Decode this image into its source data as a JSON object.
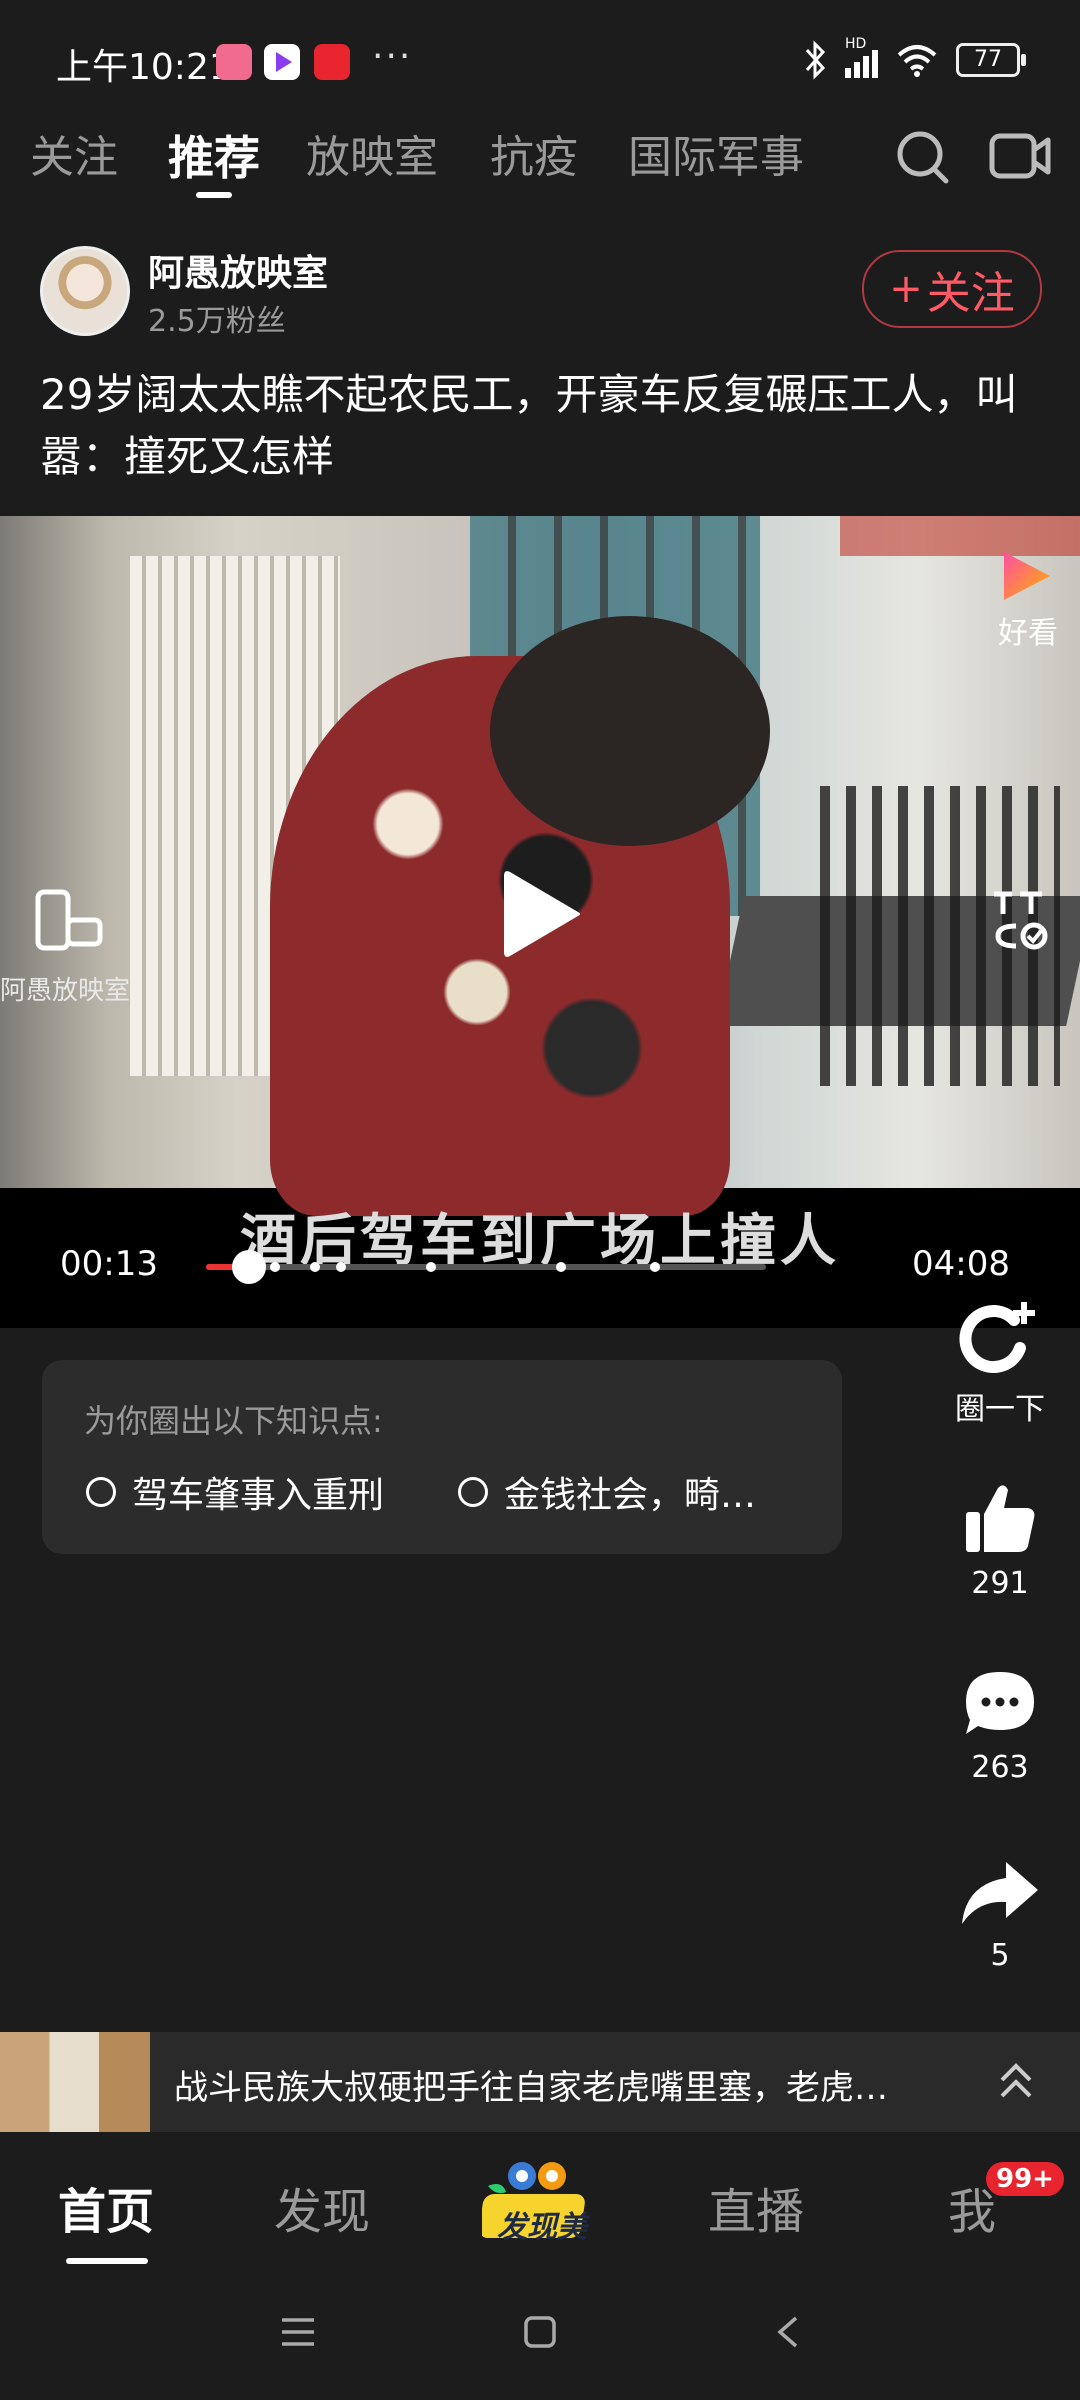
{
  "status_bar": {
    "time": "上午10:21",
    "more": "···",
    "battery": "77",
    "network_label": "HD"
  },
  "tabs": [
    {
      "label": "关注",
      "active": false
    },
    {
      "label": "推荐",
      "active": true
    },
    {
      "label": "放映室",
      "active": false
    },
    {
      "label": "抗疫",
      "active": false
    },
    {
      "label": "国际军事",
      "active": false
    }
  ],
  "author": {
    "name": "阿愚放映室",
    "fans": "2.5万粉丝",
    "follow_label": "关注"
  },
  "video": {
    "title": "29岁阔太太瞧不起农民工，开豪车反复碾压工人，叫嚣：撞死又怎样",
    "watermark_app": "好看",
    "watermark_author": "阿愚放映室",
    "subtitle": "酒后驾车到广场上撞人",
    "current_time": "00:13",
    "total_time": "04:08",
    "progress": 0.053
  },
  "knowledge": {
    "title": "为你圈出以下知识点:",
    "items": [
      "驾车肇事入重刑",
      "金钱社会，畸…"
    ]
  },
  "actions": {
    "circle_label": "圈一下",
    "likes": "291",
    "comments": "263",
    "shares": "5"
  },
  "next_video": {
    "title": "战斗民族大叔硬把手往自家老虎嘴里塞，老虎…"
  },
  "bottom_nav": {
    "home": "首页",
    "discover": "发现",
    "logo_text": "发现美",
    "live": "直播",
    "me": "我",
    "badge": "99+"
  },
  "colors": {
    "background": "#1c1c1c",
    "follow_red": "#ff5a66",
    "badge_red": "#e8242f"
  }
}
